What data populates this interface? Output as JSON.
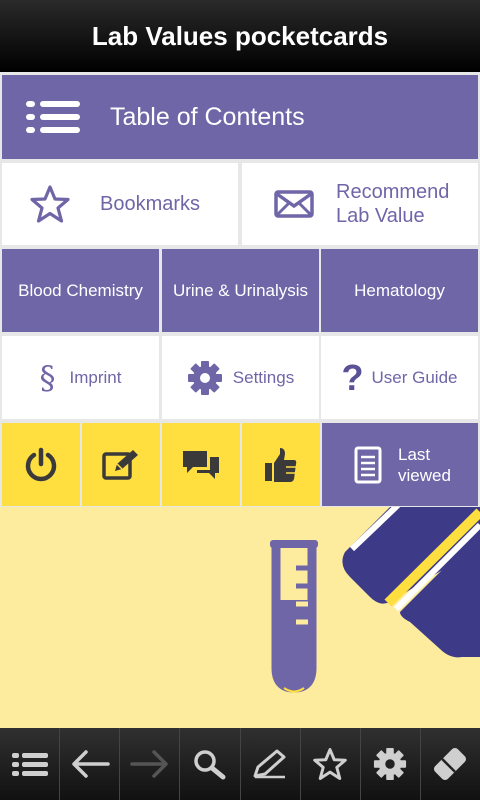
{
  "app": {
    "title": "Lab Values pocketcards"
  },
  "menu": {
    "toc_label": "Table of Contents",
    "bookmarks_label": "Bookmarks",
    "recommend_line1": "Recommend",
    "recommend_line2": "Lab Value",
    "categories": [
      "Blood Chemistry",
      "Urine & Urinalysis",
      "Hematology"
    ],
    "imprint_label": "Imprint",
    "settings_label": "Settings",
    "guide_label": "User Guide",
    "last_line1": "Last",
    "last_line2": "viewed"
  },
  "toolbar": {
    "icons": [
      "list-icon",
      "back-arrow-icon",
      "forward-arrow-icon",
      "search-icon",
      "pencil-icon",
      "star-icon",
      "gear-icon",
      "eraser-icon"
    ]
  },
  "colors": {
    "purple": "#6f66a8",
    "yellow": "#ffde3f",
    "cream": "#fdeb9e",
    "dark": "#3a3a3a"
  }
}
